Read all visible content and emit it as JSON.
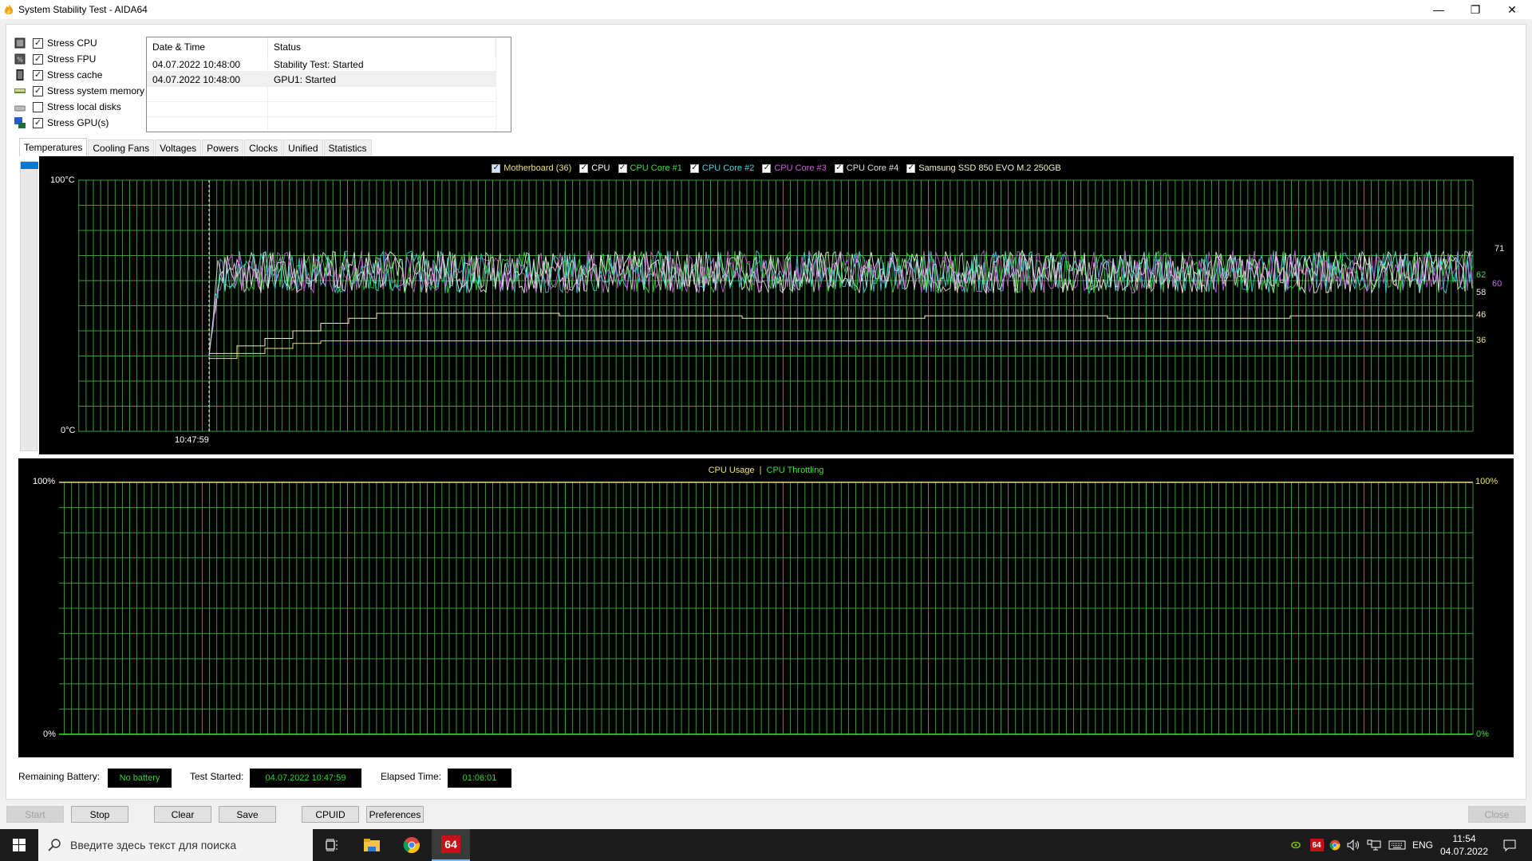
{
  "window": {
    "title": "System Stability Test - AIDA64",
    "controls": {
      "minimize": "—",
      "restore": "❐",
      "close": "✕"
    }
  },
  "stress_options": [
    {
      "label": "Stress CPU",
      "checked": true,
      "icon": "cpu-icon"
    },
    {
      "label": "Stress FPU",
      "checked": true,
      "icon": "fpu-icon"
    },
    {
      "label": "Stress cache",
      "checked": true,
      "icon": "cache-icon"
    },
    {
      "label": "Stress system memory",
      "checked": true,
      "icon": "memory-icon"
    },
    {
      "label": "Stress local disks",
      "checked": false,
      "icon": "disk-icon"
    },
    {
      "label": "Stress GPU(s)",
      "checked": true,
      "icon": "gpu-icon"
    }
  ],
  "log": {
    "columns": [
      "Date & Time",
      "Status"
    ],
    "rows": [
      {
        "datetime": "04.07.2022 10:48:00",
        "status": "Stability Test: Started"
      },
      {
        "datetime": "04.07.2022 10:48:00",
        "status": "GPU1: Started"
      }
    ]
  },
  "tabs": [
    {
      "label": "Temperatures",
      "active": true
    },
    {
      "label": "Cooling Fans",
      "active": false
    },
    {
      "label": "Voltages",
      "active": false
    },
    {
      "label": "Powers",
      "active": false
    },
    {
      "label": "Clocks",
      "active": false
    },
    {
      "label": "Unified",
      "active": false
    },
    {
      "label": "Statistics",
      "active": false
    }
  ],
  "chart_data": [
    {
      "type": "line",
      "title": "Temperatures",
      "ylabel_top": "100°C",
      "ylabel_bottom": "0°C",
      "ylim": [
        0,
        100
      ],
      "grid": true,
      "start_marker_label": "10:47:59",
      "legend_position": "top-center",
      "legend": [
        {
          "name": "Motherboard (36)",
          "color": "#e8e07a",
          "checked": true,
          "highlighted": true
        },
        {
          "name": "CPU",
          "color": "#ffffff",
          "checked": true
        },
        {
          "name": "CPU Core #1",
          "color": "#3ce03c",
          "checked": true
        },
        {
          "name": "CPU Core #2",
          "color": "#40d8e0",
          "checked": true
        },
        {
          "name": "CPU Core #3",
          "color": "#d060e0",
          "checked": true
        },
        {
          "name": "CPU Core #4",
          "color": "#e0e0e0",
          "checked": true
        },
        {
          "name": "Samsung SSD 850 EVO M.2 250GB",
          "color": "#f0f0c8",
          "checked": true
        }
      ],
      "current_values": [
        {
          "series": "CPU",
          "value": 71,
          "color": "#e8e8e8"
        },
        {
          "series": "CPU Core #1",
          "value": 62,
          "color": "#3ce03c"
        },
        {
          "series": "CPU Core #3",
          "value": 60,
          "color": "#c070e8"
        },
        {
          "series": "CPU Core #4",
          "value": 58,
          "color": "#e8e8e8"
        },
        {
          "series": "Samsung SSD 850 EVO M.2 250GB",
          "value": 46,
          "color": "#f0e8c0"
        },
        {
          "series": "Motherboard",
          "value": 36,
          "color": "#e8e07a"
        }
      ],
      "series_summary": {
        "cpu_cores_range": [
          55,
          72
        ],
        "ssd_steps": [
          31,
          34,
          37,
          40,
          43,
          45,
          47,
          46,
          45,
          46,
          45,
          46
        ],
        "motherboard_steps": [
          29,
          31,
          33,
          35,
          36
        ]
      }
    },
    {
      "type": "line",
      "title": "CPU Usage | CPU Throttling",
      "legend": [
        {
          "name": "CPU Usage",
          "color": "#e8e07a"
        },
        {
          "name": "CPU Throttling",
          "color": "#3ce03c"
        }
      ],
      "separator": "|",
      "ylabel_top": "100%",
      "ylabel_bottom": "0%",
      "right_top": "100%",
      "right_bottom": "0%",
      "ylim": [
        0,
        100
      ],
      "grid": true,
      "cpu_usage": 100,
      "cpu_throttling": 0
    }
  ],
  "status": {
    "battery_label": "Remaining Battery:",
    "battery_value": "No battery",
    "test_started_label": "Test Started:",
    "test_started_value": "04.07.2022 10:47:59",
    "elapsed_label": "Elapsed Time:",
    "elapsed_value": "01:06:01"
  },
  "buttons": {
    "start": "Start",
    "stop": "Stop",
    "clear": "Clear",
    "save": "Save",
    "cpuid": "CPUID",
    "preferences": "Preferences",
    "close": "Close"
  },
  "taskbar": {
    "search_placeholder": "Введите здесь текст для поиска",
    "aida_label": "64",
    "lang": "ENG",
    "time": "11:54",
    "date": "04.07.2022"
  }
}
